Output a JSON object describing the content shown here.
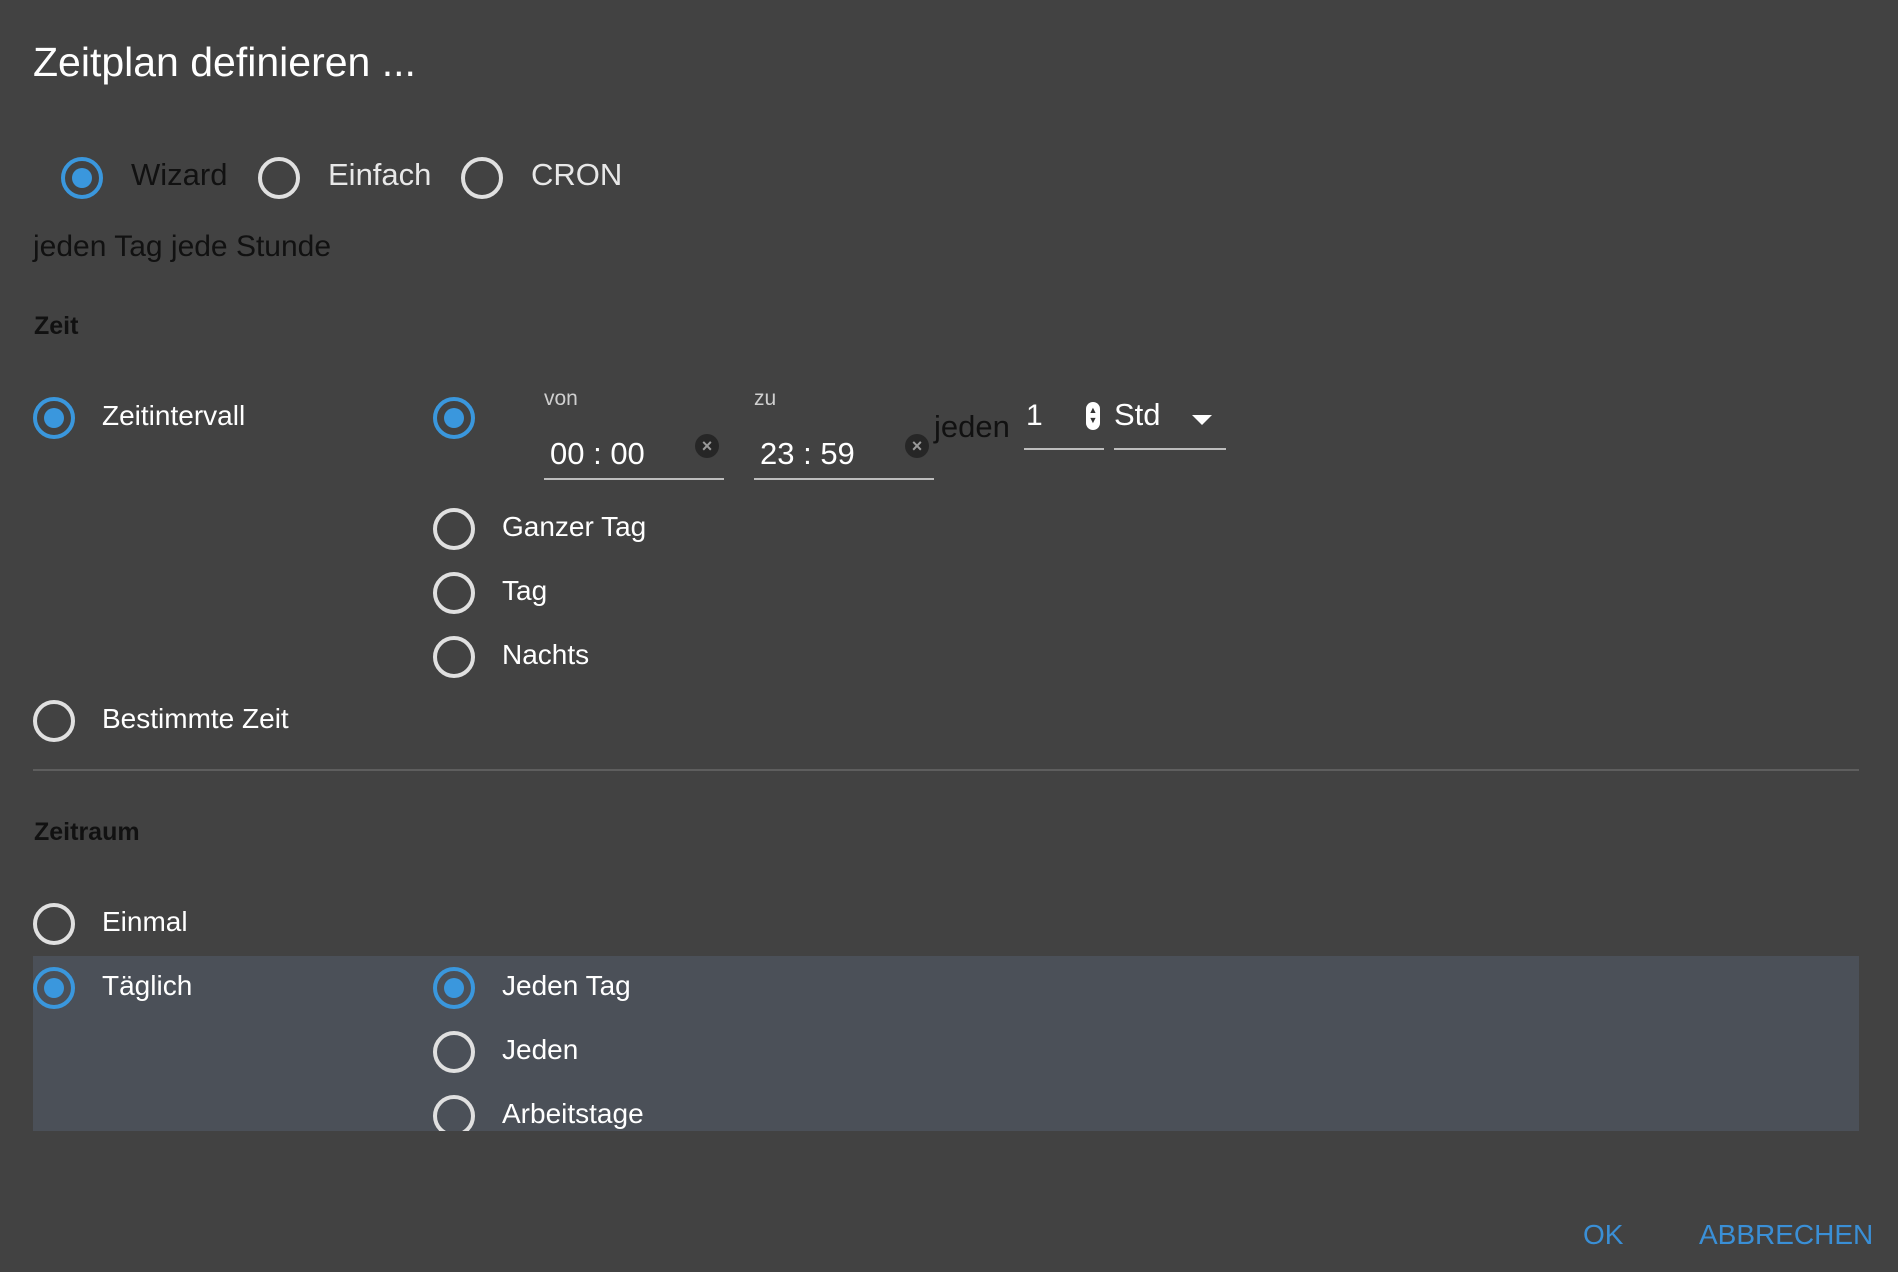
{
  "dialog": {
    "title": "Zeitplan definieren ...",
    "mode_options": [
      {
        "label": "Wizard",
        "checked": true
      },
      {
        "label": "Einfach",
        "checked": false
      },
      {
        "label": "CRON",
        "checked": false
      }
    ],
    "summary": "jeden Tag jede Stunde"
  },
  "zeit": {
    "heading": "Zeit",
    "options": [
      {
        "label": "Zeitintervall",
        "checked": true
      },
      {
        "label": "Bestimmte Zeit",
        "checked": false
      }
    ],
    "interval": {
      "range_checked": true,
      "von_label": "von",
      "von_value": "00 : 00",
      "zu_label": "zu",
      "zu_value": "23 : 59",
      "jeden_label": "jeden",
      "every_value": "1",
      "unit_value": "Std",
      "sub_options": [
        {
          "label": "Ganzer Tag",
          "checked": false
        },
        {
          "label": "Tag",
          "checked": false
        },
        {
          "label": "Nachts",
          "checked": false
        }
      ]
    }
  },
  "zeitraum": {
    "heading": "Zeitraum",
    "options": [
      {
        "label": "Einmal",
        "checked": false
      },
      {
        "label": "Täglich",
        "checked": true
      }
    ],
    "daily_sub_options": [
      {
        "label": "Jeden Tag",
        "checked": true
      },
      {
        "label": "Jeden",
        "checked": false
      },
      {
        "label": "Arbeitstage",
        "checked": false
      }
    ]
  },
  "actions": {
    "ok_label": "OK",
    "cancel_label": "ABBRECHEN"
  },
  "colors": {
    "background": "#424242",
    "accent": "#3a97dd",
    "highlight_row": "#4b5058",
    "button_text": "#3a8fd6"
  }
}
